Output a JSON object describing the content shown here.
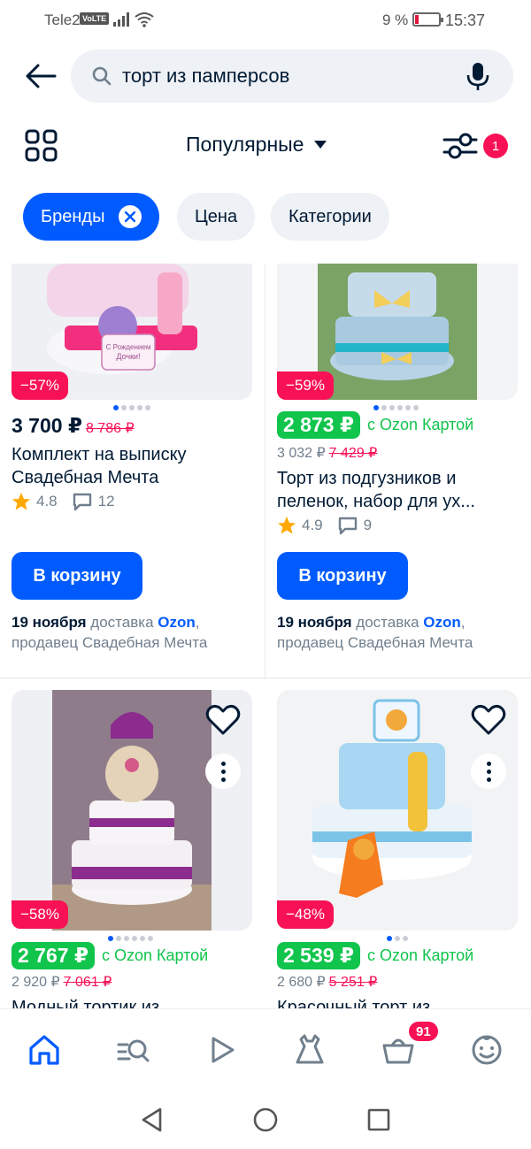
{
  "status_bar": {
    "carrier": "Tele2",
    "volte": "VoLTE",
    "battery_percent": "9 %",
    "time": "15:37"
  },
  "search": {
    "query": "торт из памперсов"
  },
  "sort": {
    "label": "Популярные"
  },
  "filter": {
    "badge_count": "1"
  },
  "chips": [
    {
      "label": "Бренды",
      "active": true
    },
    {
      "label": "Цена",
      "active": false
    },
    {
      "label": "Категории",
      "active": false
    }
  ],
  "products": [
    {
      "discount": "−57%",
      "price": "3 700 ₽",
      "old_price": "8 786 ₽",
      "title_line1": "Комплект на выписку",
      "title_line2": "Свадебная Мечта",
      "rating": "4.8",
      "reviews": "12",
      "cart_label": "В корзину",
      "delivery_date": "19 ноября",
      "delivery_text": "доставка",
      "delivery_ozon": "Ozon",
      "seller": "продавец Свадебная Мечта"
    },
    {
      "discount": "−59%",
      "price": "2 873 ₽",
      "card_label": "с Ozon Картой",
      "regular_price": "3 032 ₽",
      "old_price": "7 429 ₽",
      "title_line1": "Торт из подгузников и",
      "title_line2": "пеленок, набор для ух...",
      "rating": "4.9",
      "reviews": "9",
      "cart_label": "В корзину",
      "delivery_date": "19 ноября",
      "delivery_text": "доставка",
      "delivery_ozon": "Ozon",
      "seller": "продавец Свадебная Мечта"
    },
    {
      "discount": "−58%",
      "price": "2 767 ₽",
      "card_label": "с Ozon Картой",
      "regular_price": "2 920 ₽",
      "old_price": "7 061 ₽",
      "title_line1": "Модный тортик из"
    },
    {
      "discount": "−48%",
      "price": "2 539 ₽",
      "card_label": "с Ozon Картой",
      "regular_price": "2 680 ₽",
      "old_price": "5 251 ₽",
      "title_line1": "Красочный торт из"
    }
  ],
  "image_texts": {
    "sign_line1": "С Рождением",
    "sign_line2": "Дочки!"
  },
  "bottom_nav": {
    "cart_badge": "91"
  },
  "colors": {
    "accent": "#005bff",
    "sale": "#f91155",
    "green": "#10c44c"
  }
}
